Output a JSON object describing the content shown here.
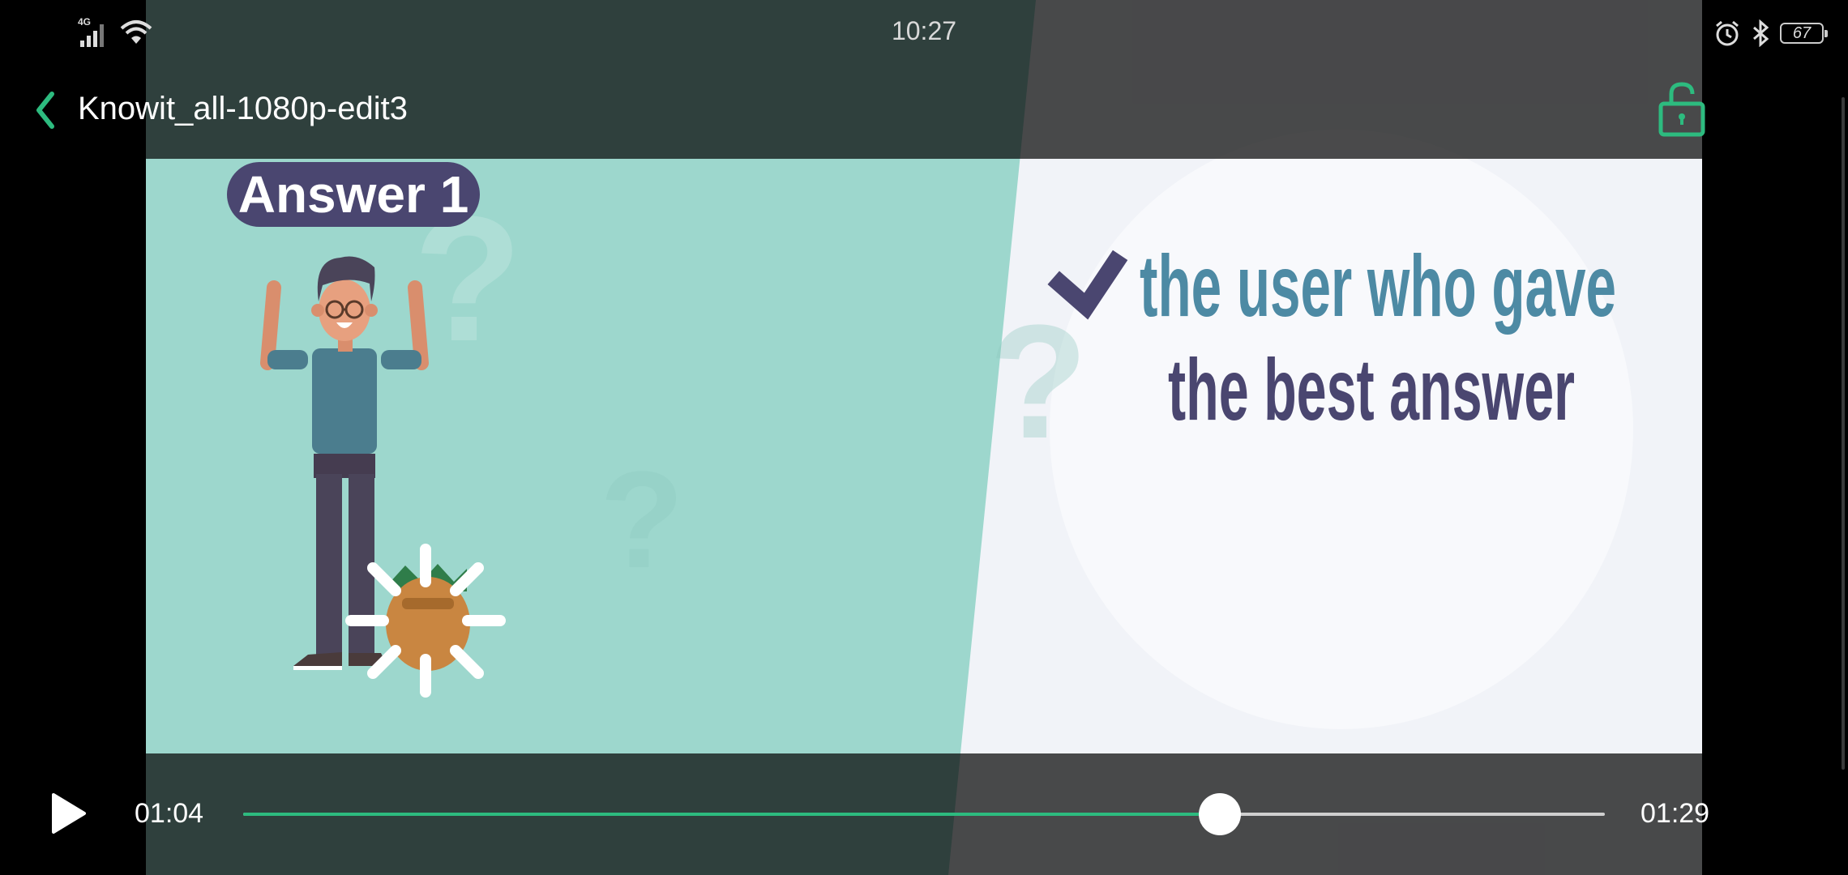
{
  "status_bar": {
    "time": "10:27",
    "network": "4G",
    "battery": "67"
  },
  "player": {
    "title": "Knowit_all-1080p-edit3",
    "current_time": "01:04",
    "total_time": "01:29",
    "progress": 0.717
  },
  "video_frame": {
    "badge": "Answer 1",
    "line1": "the user who gave",
    "line2": "the best answer"
  },
  "colors": {
    "accent": "#2dbb7f",
    "teal_panel": "#9dd7cd",
    "badge_bg": "#4a4670",
    "text_blue": "#4d8aa4",
    "text_dark": "#4a4670"
  },
  "icons": {
    "back": "chevron-left-icon",
    "lock": "unlock-icon",
    "play": "play-icon"
  }
}
